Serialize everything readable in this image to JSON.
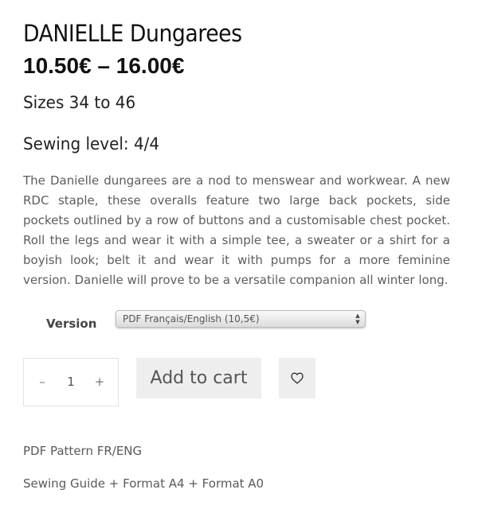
{
  "product": {
    "title": "DANIELLE Dungarees",
    "price_range": "10.50€ – 16.00€",
    "sizes": "Sizes 34 to 46",
    "sewing_level": "Sewing level: 4/4",
    "description": "The Danielle dungarees are a nod to menswear and workwear. A new RDC staple, these overalls feature two large back pockets, side pockets outlined by a row of buttons and a customisable chest pocket. Roll the legs and wear it with a simple tee, a sweater or a shirt for a boyish look; belt it and wear it with pumps for a more feminine version. Danielle will prove to be a versatile companion all winter long."
  },
  "variation": {
    "label": "Version",
    "selected": "PDF Français/English (10,5€)"
  },
  "cart": {
    "minus_symbol": "–",
    "plus_symbol": "+",
    "quantity": "1",
    "add_label": "Add to cart",
    "wishlist_icon": "heart-outline-icon"
  },
  "meta": {
    "line1": "PDF Pattern FR/ENG",
    "line2": "Sewing Guide + Format A4 + Format A0"
  },
  "colors": {
    "text_dark": "#111111",
    "text_body": "#5d5d5d",
    "button_bg": "#eeeeee",
    "border": "#e3e3e3"
  }
}
